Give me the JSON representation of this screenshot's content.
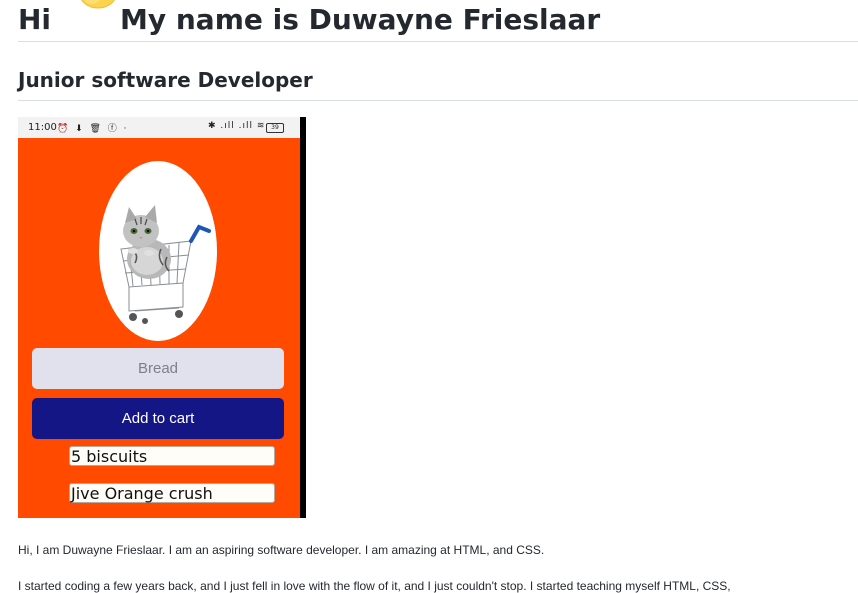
{
  "heading": {
    "hi": "Hi",
    "name": "My name is Duwayne Frieslaar",
    "wave_icon": "waving-hand-emoji"
  },
  "subheading": "Junior software Developer",
  "phone": {
    "status": {
      "time": "11:00",
      "left_icons": "⏰ ⬇ 🗑 ⓕ ·",
      "right_icons": "✱ .ıll .ıll ≋",
      "battery": "39"
    },
    "image": "cat-in-shopping-cart",
    "input_placeholder": "Bread",
    "add_button": "Add to cart",
    "items": [
      "5 biscuits",
      "Jive Orange crush"
    ],
    "colors": {
      "background": "#ff4a00",
      "button": "#141685",
      "input": "#e0e1ec"
    }
  },
  "paragraphs": [
    "Hi, I am Duwayne Frieslaar. I am an aspiring software developer. I am amazing at HTML, and CSS.",
    "I started coding a few years back, and I just fell in love with the flow of it, and I just couldn't stop. I started teaching myself HTML, CSS,"
  ]
}
